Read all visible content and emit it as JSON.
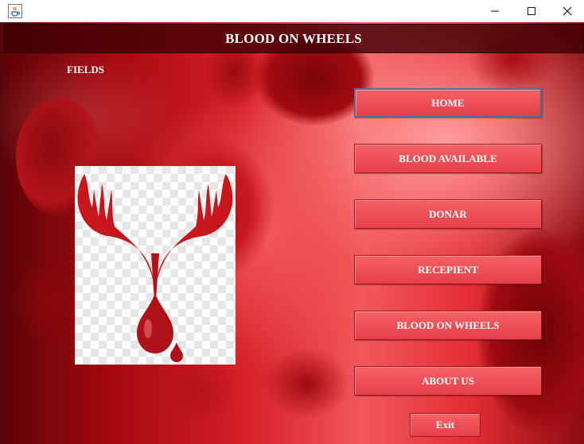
{
  "window": {
    "app_icon": "java-cup-icon",
    "controls": {
      "minimize": "minimize-icon",
      "maximize": "maximize-icon",
      "close": "close-icon"
    }
  },
  "header": {
    "title": "BLOOD ON WHEELS"
  },
  "fields_label": "FIELDS",
  "logo": {
    "icon": "hands-blood-drop-icon",
    "colors": {
      "red": "#c8161d",
      "dark_red": "#7d0a0d"
    }
  },
  "nav": [
    {
      "label": "HOME",
      "focused": true
    },
    {
      "label": "BLOOD AVAILABLE"
    },
    {
      "label": "DONAR"
    },
    {
      "label": "RECEPIENT"
    },
    {
      "label": "BLOOD ON WHEELS"
    },
    {
      "label": "ABOUT US"
    }
  ],
  "exit_label": "Exit",
  "colors": {
    "button": "#ee4b53",
    "header_bg": "#3c0004",
    "text": "#ffffff"
  }
}
